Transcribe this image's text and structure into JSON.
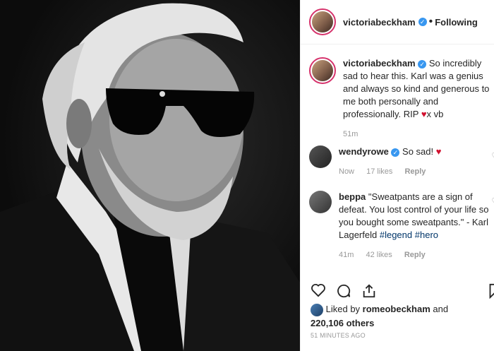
{
  "post": {
    "author": "victoriabeckham",
    "follow_separator": "•",
    "follow_status": "Following"
  },
  "caption": {
    "author": "victoriabeckham",
    "text_part1": "So incredibly sad to hear this. Karl was a genius and always so kind and generous to me both personally and professionally. RIP",
    "text_part2": "x vb",
    "time": "51m"
  },
  "comments": [
    {
      "author": "wendyrowe",
      "text": "So sad!",
      "time": "Now",
      "likes": "17 likes",
      "reply": "Reply"
    },
    {
      "author": "beppa",
      "text": "\"Sweatpants are a sign of defeat. You lost control of your life so you bought some sweatpants.\" - Karl Lagerfeld",
      "hashtag1": "#legend",
      "hashtag2": "#hero",
      "time": "41m",
      "likes": "42 likes",
      "reply": "Reply"
    }
  ],
  "likes": {
    "prefix": "Liked by",
    "user": "romeobeckham",
    "and": "and",
    "count": "220,106 others"
  },
  "timestamp": "51 MINUTES AGO",
  "icons": [
    "heart-icon",
    "comment-icon",
    "share-icon",
    "bookmark-icon",
    "verified-icon"
  ],
  "colors": {
    "verified": "#3897f0",
    "heart": "#d1112f",
    "hashtag": "#003569",
    "story_ring": "#d6336c"
  }
}
